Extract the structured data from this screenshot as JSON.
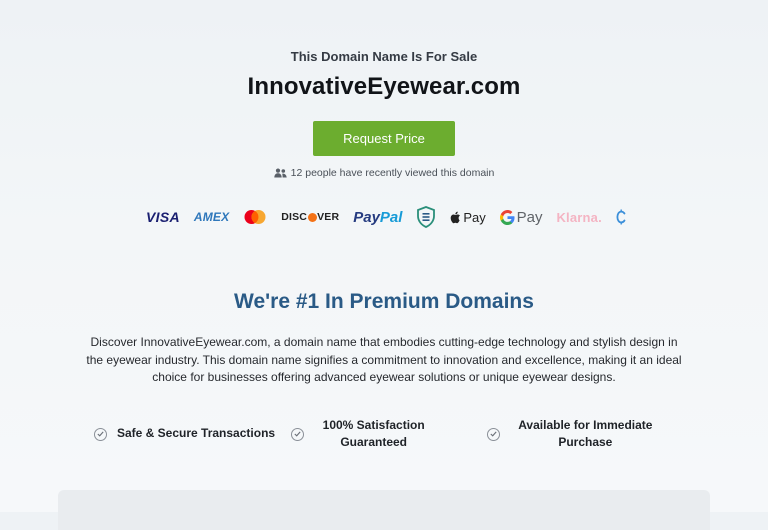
{
  "hero": {
    "eyebrow": "This Domain Name Is For Sale",
    "domain": "InnovativeEyewear.com",
    "cta_label": "Request Price",
    "viewers_text": "12 people have recently viewed this domain"
  },
  "payments": {
    "visa": "VISA",
    "amex": "AMEX",
    "discover_left": "DISC",
    "discover_right": "VER",
    "paypal_pay": "Pay",
    "paypal_pal": "Pal",
    "apple_pay": "Pay",
    "google_pay": "Pay",
    "klarna": "Klarna."
  },
  "about": {
    "title": "We're #1 In Premium Domains",
    "description": "Discover InnovativeEyewear.com, a domain name that embodies cutting-edge technology and stylish design in the eyewear industry. This domain name signifies a commitment to innovation and excellence, making it an ideal choice for businesses offering advanced eyewear solutions or unique eyewear designs."
  },
  "features": [
    {
      "label": "Safe & Secure Transactions"
    },
    {
      "label": "100% Satisfaction Guaranteed"
    },
    {
      "label": "Available for Immediate Purchase"
    }
  ],
  "colors": {
    "cta": "#6cad2f",
    "section_title": "#2a5a86",
    "background": "#eef2f5"
  },
  "icons": [
    "users-icon",
    "mastercard-icon",
    "escrow-shield-icon",
    "apple-icon",
    "google-g-icon",
    "crypto-icon",
    "check-circle-icon"
  ]
}
